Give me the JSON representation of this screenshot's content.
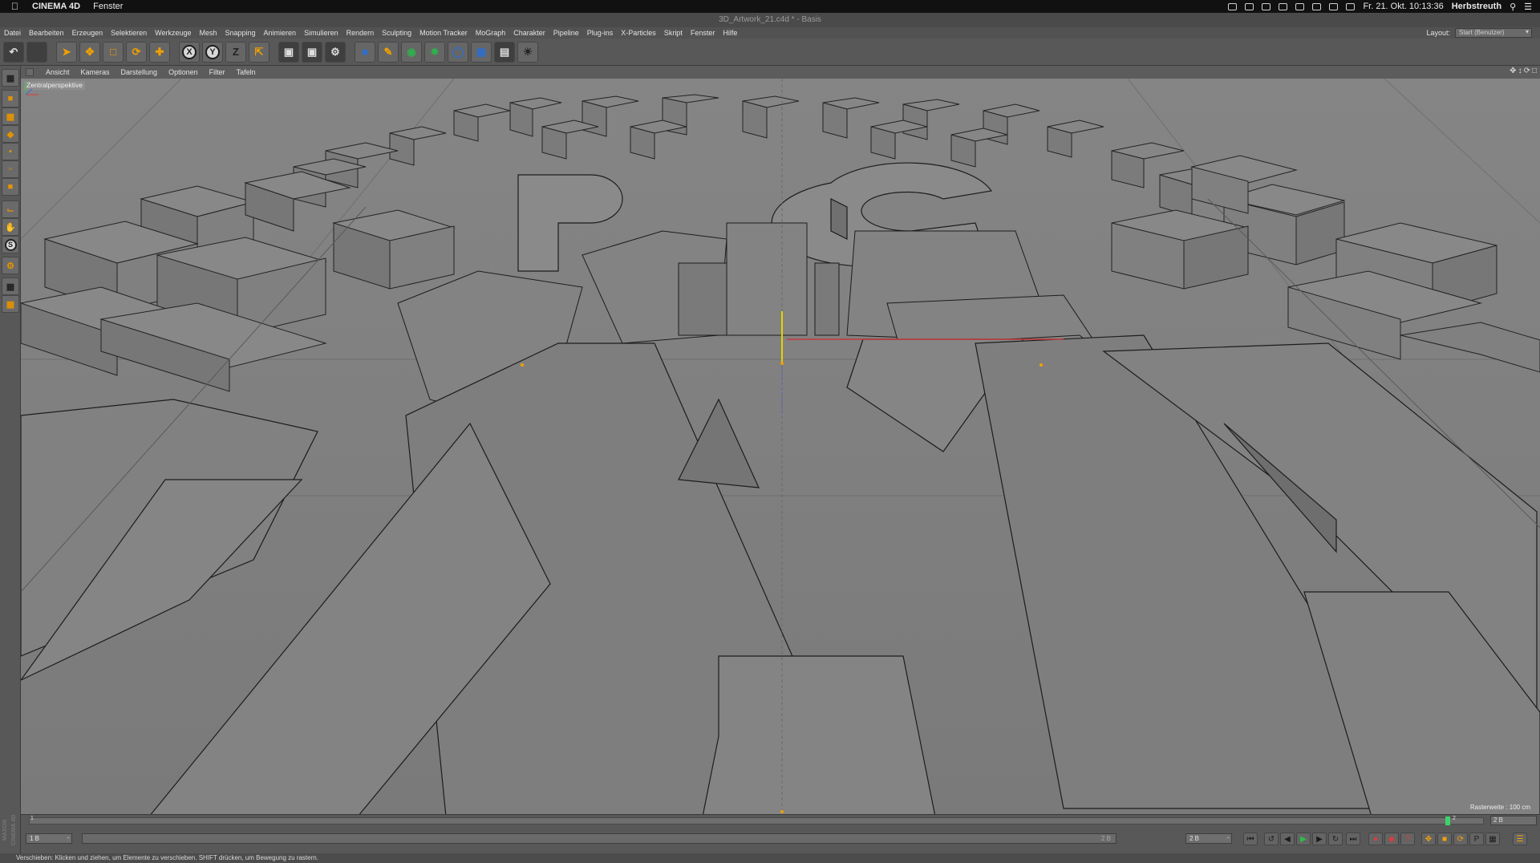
{
  "macos": {
    "app_name": "CINEMA 4D",
    "menus": [
      "Fenster"
    ],
    "clock": "Fr. 21. Okt.  10:13:36",
    "user": "Herbstreuth"
  },
  "window": {
    "title": "3D_Artwork_21.c4d * - Basis"
  },
  "app_menu": {
    "items": [
      "Datei",
      "Bearbeiten",
      "Erzeugen",
      "Selektieren",
      "Werkzeuge",
      "Mesh",
      "Snapping",
      "Animieren",
      "Simulieren",
      "Rendern",
      "Sculpting",
      "Motion Tracker",
      "MoGraph",
      "Charakter",
      "Pipeline",
      "Plug-ins",
      "X-Particles",
      "Skript",
      "Fenster",
      "Hilfe"
    ],
    "layout_label": "Layout:",
    "layout_value": "Start (Benutzer)"
  },
  "toolbar": {
    "axis_x": "X",
    "axis_y": "Y",
    "axis_z": "Z"
  },
  "viewport_menu": {
    "items": [
      "Ansicht",
      "Kameras",
      "Darstellung",
      "Optionen",
      "Filter",
      "Tafeln"
    ]
  },
  "viewport": {
    "camera_label": "Zentralperspektive",
    "grid_label": "Rasterweite : 100 cm"
  },
  "timeline": {
    "start_frame": "1",
    "current_frame": "2",
    "end_field": "2 B"
  },
  "transport": {
    "current_field": "1 B",
    "slider_end": "2 B",
    "end_field": "2 B"
  },
  "left_palette": {
    "sculpt_label": "S"
  },
  "branding": {
    "vertical": "MAXON CINEMA 4D"
  },
  "status": {
    "text": "Verschieben: Klicken und ziehen, um Elemente zu verschieben. SHIFT drücken, um Bewegung zu rastern."
  },
  "colors": {
    "viewport_bg": "#7d7d7d",
    "ui_panel": "#585858",
    "accent_orange": "#f0a000",
    "play_green": "#29c14a",
    "record_red": "#e23a3a"
  }
}
